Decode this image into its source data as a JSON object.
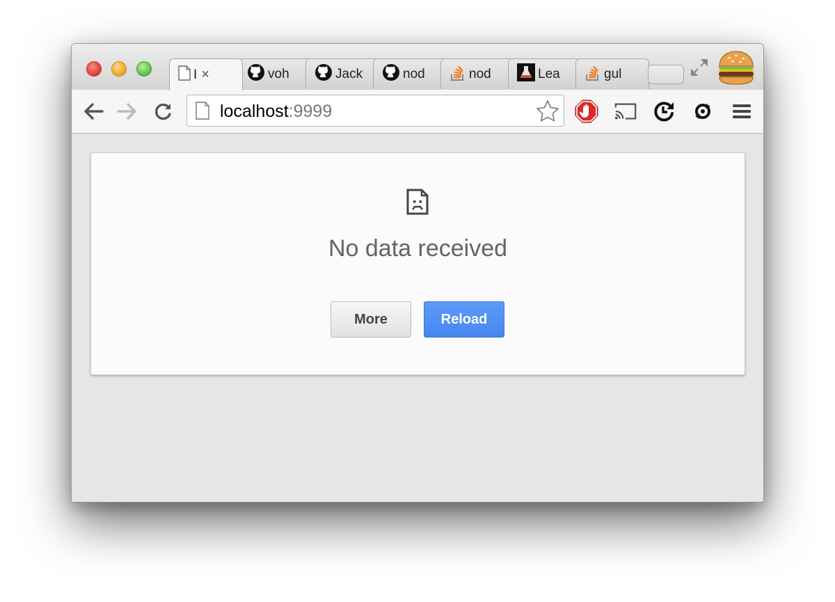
{
  "window": {
    "tabs": [
      {
        "label": "I",
        "icon": "page-icon",
        "active": true
      },
      {
        "label": "voh",
        "icon": "github-icon"
      },
      {
        "label": "Jack",
        "icon": "github-icon"
      },
      {
        "label": "nod",
        "icon": "github-icon"
      },
      {
        "label": "nod",
        "icon": "stackoverflow-icon"
      },
      {
        "label": "Lea",
        "icon": "lab-icon"
      },
      {
        "label": "gul",
        "icon": "stackoverflow-icon"
      }
    ],
    "tab_close_glyph": "×"
  },
  "toolbar": {
    "address_host": "localhost",
    "address_port": ":9999"
  },
  "page": {
    "error_title": "No data received",
    "more_label": "More",
    "reload_label": "Reload"
  },
  "colors": {
    "reload_blue": "#4a89f3",
    "adblock_red": "#d92b27"
  }
}
